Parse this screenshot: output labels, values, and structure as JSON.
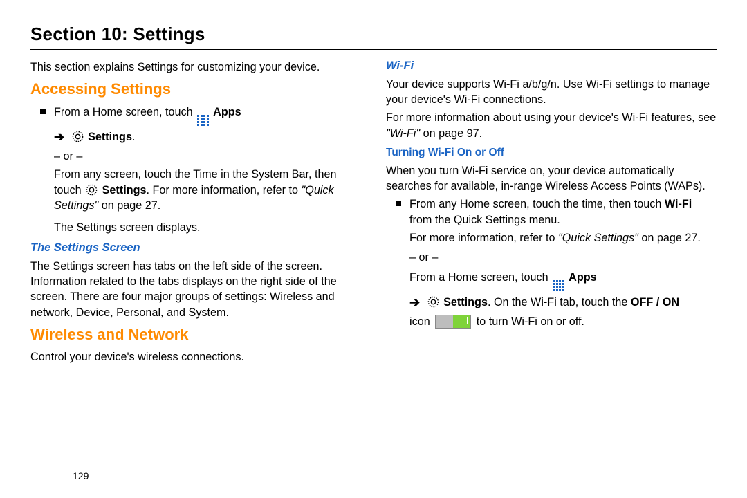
{
  "section_title": "Section 10: Settings",
  "intro": "This section explains Settings for customizing your device.",
  "left": {
    "h_accessing": "Accessing Settings",
    "from_home_prefix": "From a Home screen, touch ",
    "apps_label": "Apps",
    "arrow": "➔",
    "settings_label": "Settings",
    "or": "– or –",
    "from_any_1": "From any screen, touch the Time in the System Bar, then touch ",
    "from_any_2": ". For more information, refer to ",
    "quick_settings_ref": "\"Quick Settings\"",
    "from_any_3": " on page 27.",
    "displays": "The Settings screen displays.",
    "h_screen": "The Settings Screen",
    "screen_body": "The Settings screen has tabs on the left side of the screen. Information related to the tabs displays on the right side of the screen. There are four major groups of settings: Wireless and network, Device, Personal, and System.",
    "h_wireless": "Wireless and Network",
    "wireless_body": "Control your device's wireless connections."
  },
  "right": {
    "h_wifi": "Wi-Fi",
    "wifi_body1": "Your device supports Wi-Fi a/b/g/n. Use Wi-Fi settings to manage your device's Wi-Fi connections.",
    "wifi_body2a": "For more information about using your device's Wi-Fi features, see ",
    "wifi_ref": "\"Wi-Fi\"",
    "wifi_body2b": " on page 97.",
    "h_turning": "Turning Wi-Fi On or Off",
    "turning_body": "When you turn Wi-Fi service on, your device automatically searches for available, in-range Wireless Access Points (WAPs).",
    "step1a": "From any Home screen, touch the time, then touch ",
    "wifi_bold": "Wi-Fi",
    "step1b": " from the Quick Settings menu.",
    "step_more_a": "For more information, refer to ",
    "step_more_ref": "\"Quick Settings\"",
    "step_more_b": " on page 27.",
    "or": "– or –",
    "step2_prefix": "From a Home screen, touch ",
    "apps_label": "Apps",
    "arrow": "➔",
    "settings_label": "Settings",
    "step2_mid": ". On the Wi-Fi tab, touch the ",
    "offon": "OFF / ON",
    "step2_after": "icon ",
    "step2_end": " to turn Wi-Fi on or off."
  },
  "page_number": "129"
}
